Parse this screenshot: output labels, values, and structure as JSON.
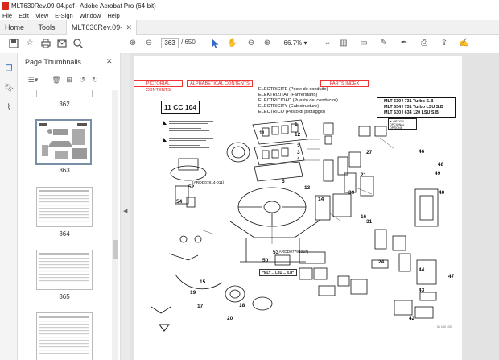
{
  "window": {
    "title": "MLT630Rev.09-04.pdf - Adobe Acrobat Pro (64-bit)"
  },
  "menu": [
    "File",
    "Edit",
    "View",
    "E-Sign",
    "Window",
    "Help"
  ],
  "tabs": {
    "home": "Home",
    "tools": "Tools",
    "doc": "MLT630Rev.09-04..."
  },
  "toolbar": {
    "page_current": "363",
    "page_total": "/ 650",
    "zoom": "66.7%"
  },
  "panel": {
    "title": "Page Thumbnails",
    "thumbs": [
      {
        "label": "362"
      },
      {
        "label": "363"
      },
      {
        "label": "364"
      },
      {
        "label": "365"
      },
      {
        "label": ""
      }
    ]
  },
  "document": {
    "links": {
      "pictorial": "PICTORIAL CONTENTS",
      "alphabetical": "ALPHABETICAL CONTENTS",
      "parts": "PARTS INDEX"
    },
    "headings": [
      "ELECTRICITE (Poste de conduite)",
      "ELEKTRIZITAT (Fahrerstand)",
      "ELECTRICIDAD (Puesto del conductor)",
      "ELECTRICITY (Cab structure)",
      "ELECTRICO (Posto di pilotaggio)"
    ],
    "section_code": "11 CC 104",
    "models": [
      "MLT 630 / 731 Turbo S.B",
      "MLT 634 / 731 Turbo LSU S.B",
      "MLT 630 / 634 120 LSU S.B"
    ],
    "ref_a": "(ARDD07814-011)",
    "ref_b": "(ARDD07794027)",
    "ref_box": "\"MLT ... LSU ... S.B\"",
    "option_note": "★ OPTION OPCIONAL OPZIONE",
    "callouts": [
      "52",
      "53",
      "54",
      "55",
      "56",
      "50",
      "42",
      "1",
      "2",
      "3",
      "4",
      "5",
      "11",
      "12",
      "13",
      "14",
      "15",
      "16",
      "17",
      "18",
      "19",
      "20",
      "21",
      "22",
      "23",
      "24",
      "25",
      "26",
      "27",
      "28",
      "29",
      "30",
      "31",
      "32",
      "33",
      "34",
      "35",
      "36",
      "37",
      "38",
      "39",
      "40",
      "41",
      "43",
      "44",
      "45",
      "46",
      "47",
      "48",
      "49",
      "51"
    ],
    "doc_id": "01 100 103"
  },
  "colors": {
    "link_red": "#dd2222",
    "selected_thumb": "#7a8ea8",
    "acrobat_red": "#d6281e",
    "accent_blue": "#3069c9"
  }
}
